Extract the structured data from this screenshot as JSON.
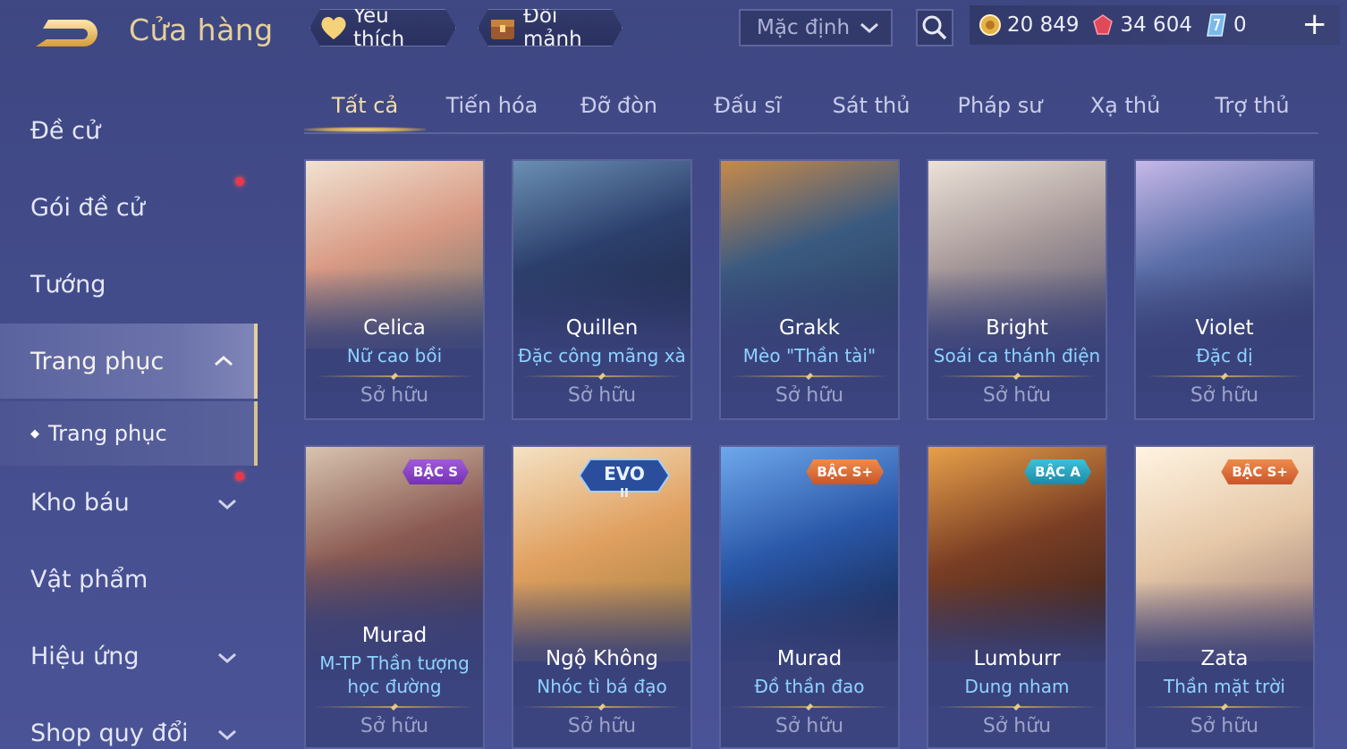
{
  "header": {
    "title": "Cửa hàng",
    "favorites_label": "Yêu thích",
    "exchange_label": "Đổi mảnh",
    "sort_value": "Mặc định",
    "currency": {
      "gold": "20 849",
      "gems": "34 604",
      "vouchers": "0"
    },
    "plus_label": "+"
  },
  "sidebar": {
    "items": [
      {
        "label": "Đề cử"
      },
      {
        "label": "Gói đề cử"
      },
      {
        "label": "Tướng"
      },
      {
        "label": "Trang phục"
      },
      {
        "label": "Kho báu"
      },
      {
        "label": "Vật phẩm"
      },
      {
        "label": "Hiệu ứng"
      },
      {
        "label": "Shop quy đổi"
      }
    ],
    "sub_item": {
      "label": "Trang phục"
    }
  },
  "tabs": [
    {
      "label": "Tất cả"
    },
    {
      "label": "Tiến hóa"
    },
    {
      "label": "Đỡ đòn"
    },
    {
      "label": "Đấu sĩ"
    },
    {
      "label": "Sát thủ"
    },
    {
      "label": "Pháp sư"
    },
    {
      "label": "Xạ thủ"
    },
    {
      "label": "Trợ thủ"
    }
  ],
  "cards": [
    {
      "hero": "Celica",
      "skin": "Nữ cao bồi",
      "status": "Sở hữu",
      "color": "#c98a6a"
    },
    {
      "hero": "Quillen",
      "skin": "Đặc công mãng xà",
      "status": "Sở hữu",
      "color": "#2f4a78"
    },
    {
      "hero": "Grakk",
      "skin": "Mèo \"Thần tài\"",
      "status": "Sở hữu",
      "color": "#3f5a7c"
    },
    {
      "hero": "Bright",
      "skin": "Soái ca thánh điện",
      "status": "Sở hữu",
      "color": "#8a8aa8"
    },
    {
      "hero": "Violet",
      "skin": "Đặc dị",
      "status": "Sở hữu",
      "color": "#4b5c8c"
    },
    {
      "hero": "Murad",
      "skin_line1": "M-TP Thần tượng",
      "skin_line2": "học đường",
      "status": "Sở hữu",
      "badge": "BẬC S",
      "color": "#7a4a52"
    },
    {
      "hero": "Ngộ Không",
      "skin": "Nhóc tì bá đạo",
      "status": "Sở hữu",
      "badge_evo": "EVO",
      "badge_evo_sub": "II",
      "color": "#c99a5a"
    },
    {
      "hero": "Murad",
      "skin": "Đồ thần đao",
      "status": "Sở hữu",
      "badge": "BẬC S+",
      "color": "#284c8c"
    },
    {
      "hero": "Lumburr",
      "skin": "Dung nham",
      "status": "Sở hữu",
      "badge": "BẬC A",
      "color": "#5a3a2e"
    },
    {
      "hero": "Zata",
      "skin": "Thần mặt trời",
      "status": "Sở hữu",
      "badge": "BẬC S+",
      "color": "#d8c2a8"
    }
  ]
}
